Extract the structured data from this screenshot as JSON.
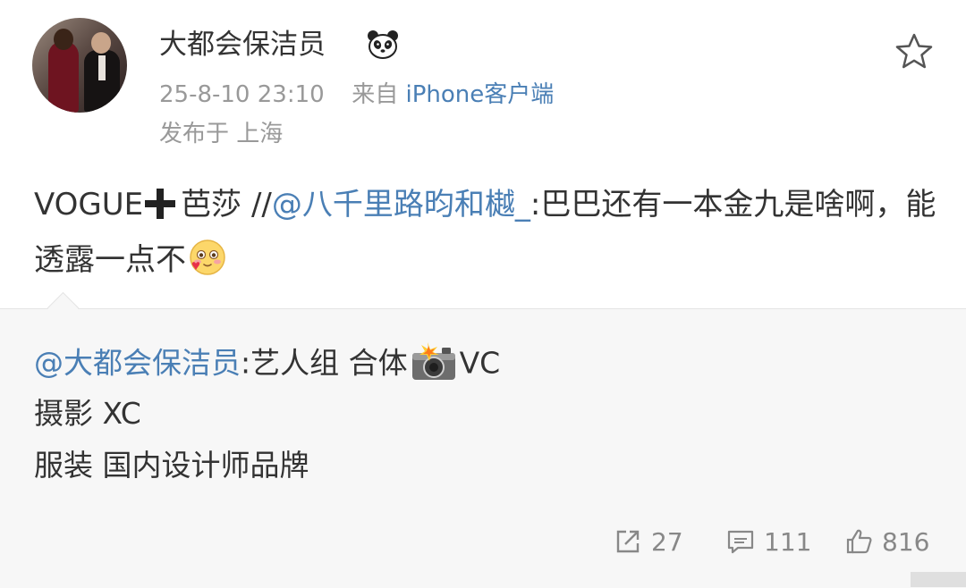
{
  "post": {
    "username": "大都会保洁员",
    "username_emoji": "panda-icon",
    "timestamp": "25-8-10 23:10",
    "source_prefix": "来自",
    "source_client": "iPhone客户端",
    "location": "发布于 上海",
    "content": {
      "text_a": "VOGUE",
      "text_b": "芭莎 //",
      "mention": "@八千里路昀和樾_",
      "text_c": ":巴巴还有一本金九是啥啊，能透露一点不"
    }
  },
  "repost": {
    "mention": "@大都会保洁员",
    "line1_text": ":艺人组 合体",
    "line1_tail": "VC",
    "line2": "摄影 XC",
    "line3": "服装 国内设计师品牌"
  },
  "actions": {
    "share_count": "27",
    "comment_count": "111",
    "like_count": "816"
  },
  "colors": {
    "link": "#4a7fb5",
    "meta": "#999999",
    "text": "#333333",
    "repost_bg": "#f7f7f7"
  }
}
